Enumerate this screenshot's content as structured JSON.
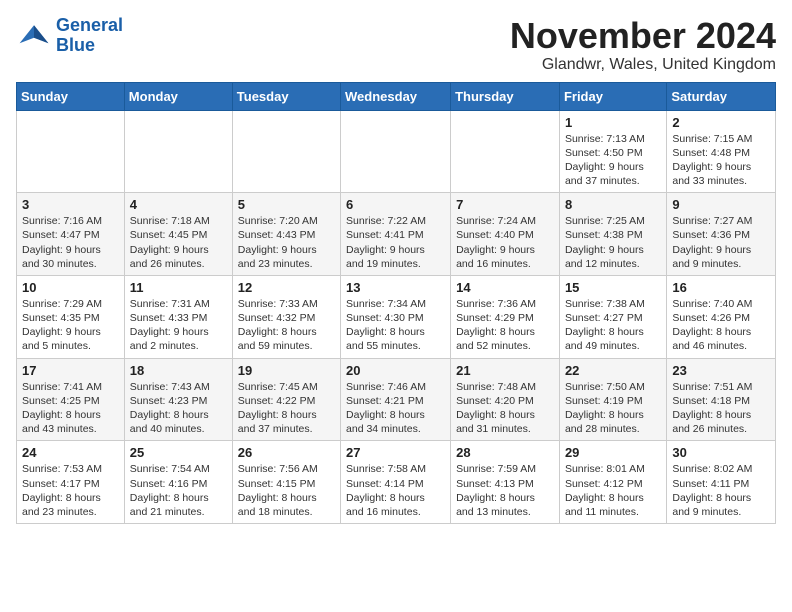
{
  "logo": {
    "line1": "General",
    "line2": "Blue"
  },
  "title": "November 2024",
  "location": "Glandwr, Wales, United Kingdom",
  "days_header": [
    "Sunday",
    "Monday",
    "Tuesday",
    "Wednesday",
    "Thursday",
    "Friday",
    "Saturday"
  ],
  "weeks": [
    [
      {
        "day": "",
        "info": ""
      },
      {
        "day": "",
        "info": ""
      },
      {
        "day": "",
        "info": ""
      },
      {
        "day": "",
        "info": ""
      },
      {
        "day": "",
        "info": ""
      },
      {
        "day": "1",
        "info": "Sunrise: 7:13 AM\nSunset: 4:50 PM\nDaylight: 9 hours and 37 minutes."
      },
      {
        "day": "2",
        "info": "Sunrise: 7:15 AM\nSunset: 4:48 PM\nDaylight: 9 hours and 33 minutes."
      }
    ],
    [
      {
        "day": "3",
        "info": "Sunrise: 7:16 AM\nSunset: 4:47 PM\nDaylight: 9 hours and 30 minutes."
      },
      {
        "day": "4",
        "info": "Sunrise: 7:18 AM\nSunset: 4:45 PM\nDaylight: 9 hours and 26 minutes."
      },
      {
        "day": "5",
        "info": "Sunrise: 7:20 AM\nSunset: 4:43 PM\nDaylight: 9 hours and 23 minutes."
      },
      {
        "day": "6",
        "info": "Sunrise: 7:22 AM\nSunset: 4:41 PM\nDaylight: 9 hours and 19 minutes."
      },
      {
        "day": "7",
        "info": "Sunrise: 7:24 AM\nSunset: 4:40 PM\nDaylight: 9 hours and 16 minutes."
      },
      {
        "day": "8",
        "info": "Sunrise: 7:25 AM\nSunset: 4:38 PM\nDaylight: 9 hours and 12 minutes."
      },
      {
        "day": "9",
        "info": "Sunrise: 7:27 AM\nSunset: 4:36 PM\nDaylight: 9 hours and 9 minutes."
      }
    ],
    [
      {
        "day": "10",
        "info": "Sunrise: 7:29 AM\nSunset: 4:35 PM\nDaylight: 9 hours and 5 minutes."
      },
      {
        "day": "11",
        "info": "Sunrise: 7:31 AM\nSunset: 4:33 PM\nDaylight: 9 hours and 2 minutes."
      },
      {
        "day": "12",
        "info": "Sunrise: 7:33 AM\nSunset: 4:32 PM\nDaylight: 8 hours and 59 minutes."
      },
      {
        "day": "13",
        "info": "Sunrise: 7:34 AM\nSunset: 4:30 PM\nDaylight: 8 hours and 55 minutes."
      },
      {
        "day": "14",
        "info": "Sunrise: 7:36 AM\nSunset: 4:29 PM\nDaylight: 8 hours and 52 minutes."
      },
      {
        "day": "15",
        "info": "Sunrise: 7:38 AM\nSunset: 4:27 PM\nDaylight: 8 hours and 49 minutes."
      },
      {
        "day": "16",
        "info": "Sunrise: 7:40 AM\nSunset: 4:26 PM\nDaylight: 8 hours and 46 minutes."
      }
    ],
    [
      {
        "day": "17",
        "info": "Sunrise: 7:41 AM\nSunset: 4:25 PM\nDaylight: 8 hours and 43 minutes."
      },
      {
        "day": "18",
        "info": "Sunrise: 7:43 AM\nSunset: 4:23 PM\nDaylight: 8 hours and 40 minutes."
      },
      {
        "day": "19",
        "info": "Sunrise: 7:45 AM\nSunset: 4:22 PM\nDaylight: 8 hours and 37 minutes."
      },
      {
        "day": "20",
        "info": "Sunrise: 7:46 AM\nSunset: 4:21 PM\nDaylight: 8 hours and 34 minutes."
      },
      {
        "day": "21",
        "info": "Sunrise: 7:48 AM\nSunset: 4:20 PM\nDaylight: 8 hours and 31 minutes."
      },
      {
        "day": "22",
        "info": "Sunrise: 7:50 AM\nSunset: 4:19 PM\nDaylight: 8 hours and 28 minutes."
      },
      {
        "day": "23",
        "info": "Sunrise: 7:51 AM\nSunset: 4:18 PM\nDaylight: 8 hours and 26 minutes."
      }
    ],
    [
      {
        "day": "24",
        "info": "Sunrise: 7:53 AM\nSunset: 4:17 PM\nDaylight: 8 hours and 23 minutes."
      },
      {
        "day": "25",
        "info": "Sunrise: 7:54 AM\nSunset: 4:16 PM\nDaylight: 8 hours and 21 minutes."
      },
      {
        "day": "26",
        "info": "Sunrise: 7:56 AM\nSunset: 4:15 PM\nDaylight: 8 hours and 18 minutes."
      },
      {
        "day": "27",
        "info": "Sunrise: 7:58 AM\nSunset: 4:14 PM\nDaylight: 8 hours and 16 minutes."
      },
      {
        "day": "28",
        "info": "Sunrise: 7:59 AM\nSunset: 4:13 PM\nDaylight: 8 hours and 13 minutes."
      },
      {
        "day": "29",
        "info": "Sunrise: 8:01 AM\nSunset: 4:12 PM\nDaylight: 8 hours and 11 minutes."
      },
      {
        "day": "30",
        "info": "Sunrise: 8:02 AM\nSunset: 4:11 PM\nDaylight: 8 hours and 9 minutes."
      }
    ]
  ]
}
